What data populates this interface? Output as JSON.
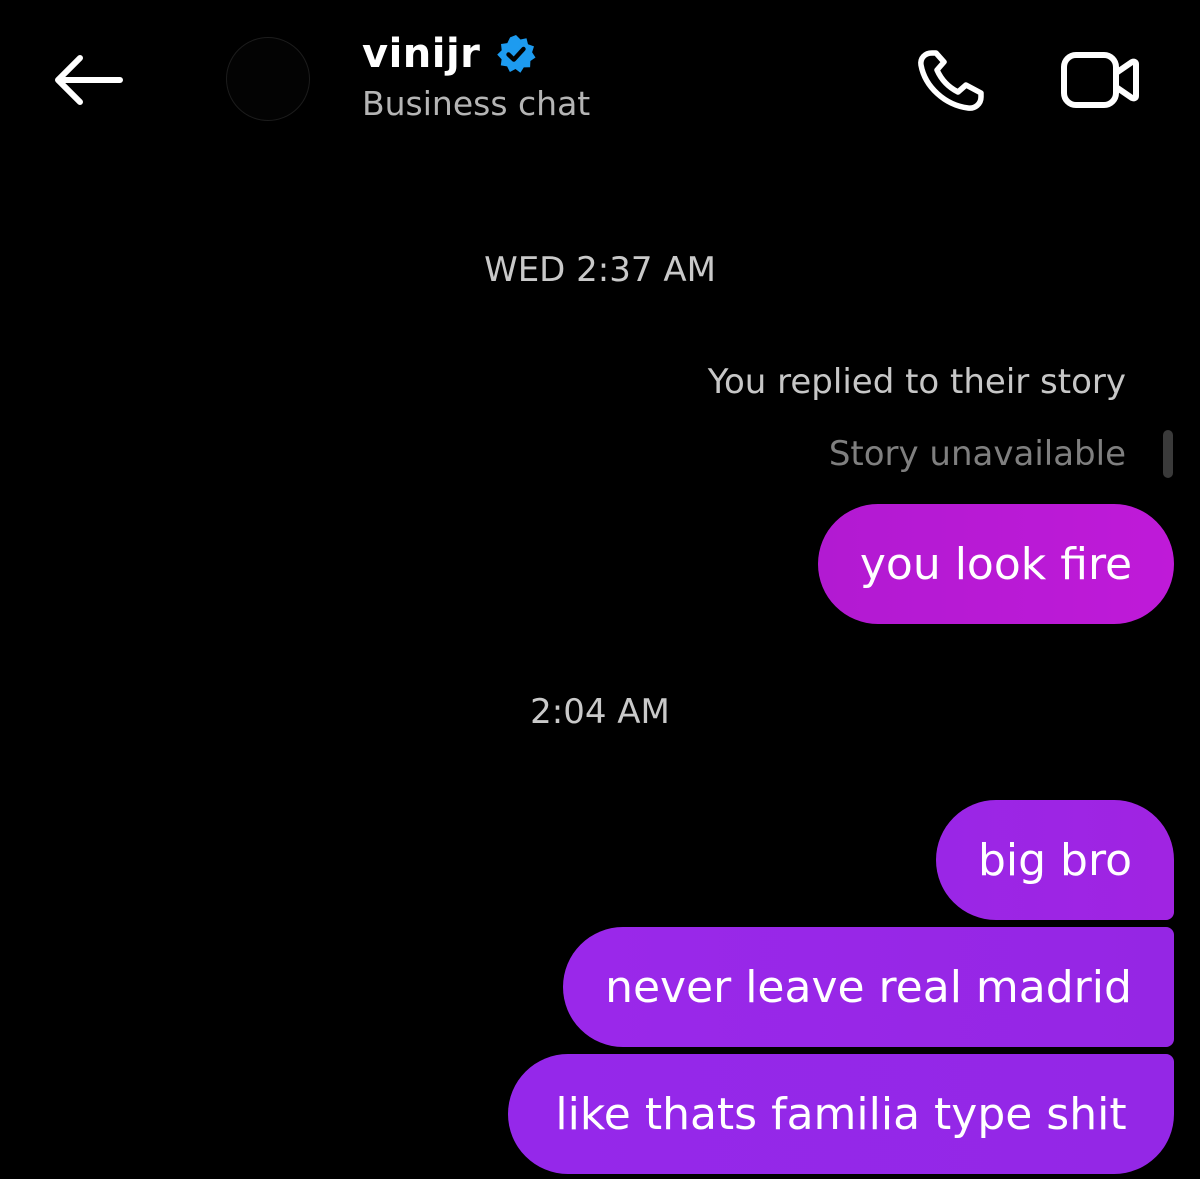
{
  "header": {
    "title": "vinijr",
    "subtitle": "Business chat",
    "verified_color": "#1d9bf0",
    "icons": {
      "back": "back-arrow-icon",
      "call": "phone-icon",
      "video": "video-camera-icon",
      "verified": "verified-badge-icon"
    }
  },
  "thread": {
    "timestamp_1": "WED 2:37 AM",
    "story_reply": {
      "note": "You replied to their story",
      "story_status": "Story unavailable"
    },
    "timestamp_2": "2:04 AM",
    "messages": [
      {
        "text": "you look fire",
        "sender": "me"
      },
      {
        "text": "big bro",
        "sender": "me"
      },
      {
        "text": "never leave real madrid",
        "sender": "me"
      },
      {
        "text": "like thats familia type shit",
        "sender": "me"
      }
    ]
  },
  "colors": {
    "background": "#000000",
    "bubble_first": "#b91ad5",
    "bubble_group": "#9727e6"
  }
}
